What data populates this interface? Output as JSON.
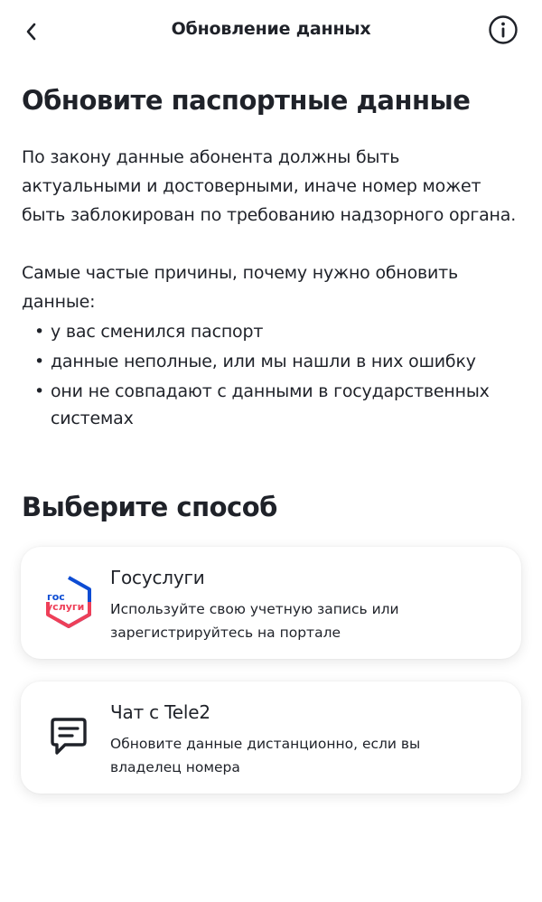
{
  "header": {
    "title": "Обновление данных",
    "back_icon": "chevron-left-icon",
    "info_icon": "info-icon"
  },
  "main": {
    "heading": "Обновите паспортные данные",
    "intro": "По закону данные абонента должны быть актуальными и достоверными, иначе номер может быть заблокирован по требованию надзорного органа.",
    "reasons_intro": "Самые частые причины, почему нужно обновить данные:",
    "reasons": [
      "у вас сменился паспорт",
      "данные неполные, или мы нашли в них ошибку",
      "они не совпадают с данными в государственных системах"
    ],
    "bullet": "•",
    "choose_heading": "Выберите способ"
  },
  "options": [
    {
      "title": "Госуслуги",
      "description": "Используйте свою учетную запись или зарегистрируйтесь на портале",
      "logo_line1": "гос",
      "logo_line2": "услуги",
      "icon": "gosuslugi-logo-icon"
    },
    {
      "title": "Чат с Tele2",
      "description": "Обновите данные дистанционно, если вы владелец номера",
      "icon": "chat-bubble-icon"
    }
  ],
  "colors": {
    "text": "#1f2229",
    "gosuslugi_blue": "#0d4cd3",
    "gosuslugi_red": "#ee3f58"
  }
}
